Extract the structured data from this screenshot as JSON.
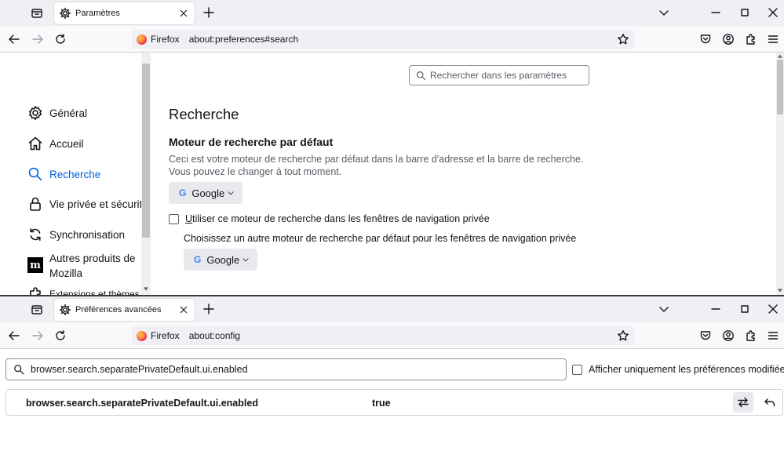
{
  "top_window": {
    "tab_title": "Paramètres",
    "url_identity": "Firefox",
    "url": "about:preferences#search",
    "search_placeholder": "Rechercher dans les paramètres",
    "sidebar": {
      "items": [
        {
          "label": "Général",
          "icon": "gear-icon"
        },
        {
          "label": "Accueil",
          "icon": "home-icon"
        },
        {
          "label": "Recherche",
          "icon": "search-icon",
          "active": true
        },
        {
          "label": "Vie privée et sécurité",
          "icon": "lock-icon"
        },
        {
          "label": "Synchronisation",
          "icon": "sync-icon"
        },
        {
          "label": "Autres produits de Mozilla",
          "icon": "mozilla-icon"
        },
        {
          "label": "Extensions et thèmes",
          "icon": "puzzle-icon"
        }
      ]
    },
    "main": {
      "page_title": "Recherche",
      "section_title": "Moteur de recherche par défaut",
      "section_desc": "Ceci est votre moteur de recherche par défaut dans la barre d'adresse et la barre de recherche. Vous pouvez le changer à tout moment.",
      "default_engine": "Google",
      "engine_logo": "G",
      "private_checkbox_label": "Utiliser ce moteur de recherche dans les fenêtres de navigation privée",
      "private_checkbox_accesskey": "U",
      "private_checkbox_rest": "tiliser ce moteur de recherche dans les fenêtres de navigation privée",
      "private_checked": false,
      "private_desc": "Choisissez un autre moteur de recherche par défaut pour les fenêtres de navigation privée",
      "private_engine": "Google"
    }
  },
  "bottom_window": {
    "tab_title": "Préférences avancées",
    "url_identity": "Firefox",
    "url": "about:config",
    "search_value": "browser.search.separatePrivateDefault.ui.enabled",
    "show_modified_label": "Afficher uniquement les préférences modifiées",
    "show_modified_checked": false,
    "rows": [
      {
        "name": "browser.search.separatePrivateDefault.ui.enabled",
        "value": "true"
      }
    ]
  },
  "colors": {
    "accent": "#0061e0",
    "tabbar": "#f0f0f4",
    "navbar": "#f9f9fb",
    "button": "#e9e9ed"
  }
}
